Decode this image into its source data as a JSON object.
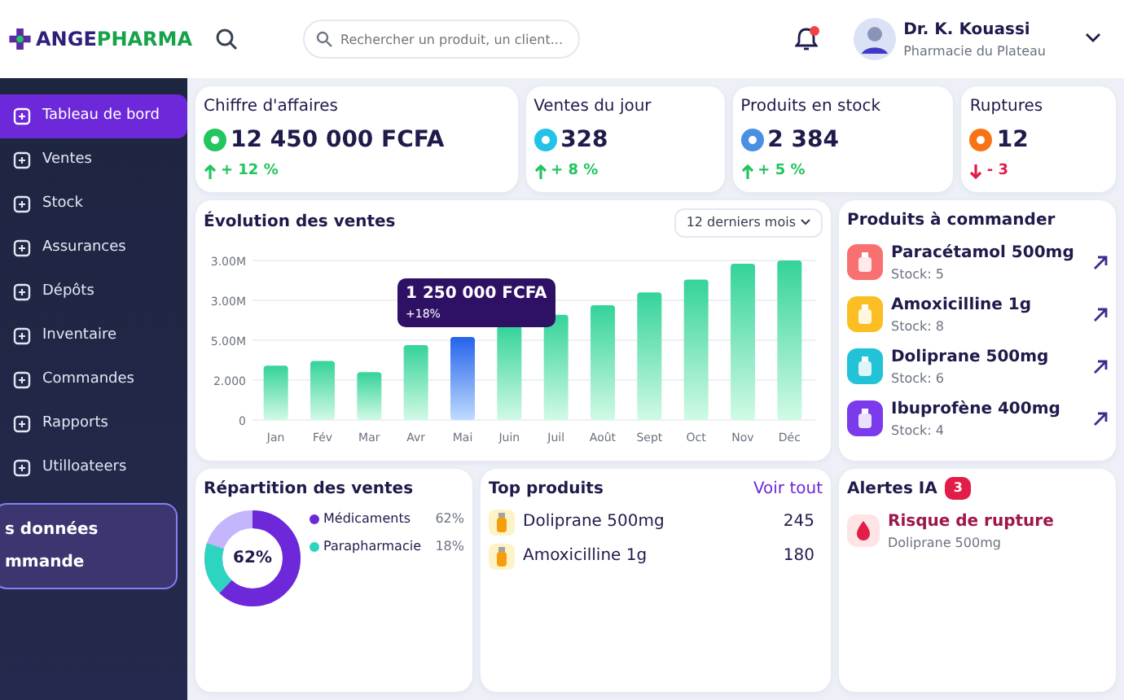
{
  "brand": {
    "part_1": "ANGE",
    "part_2": "PHARMA"
  },
  "search": {
    "placeholder": "Rechercher un produit, un client..."
  },
  "notifications": {
    "unread": true
  },
  "user": {
    "name": "Dr. K. Kouassi",
    "pharmacy": "Pharmacie du Plateau"
  },
  "sidebar": {
    "items": [
      {
        "label": "Tableau de bord",
        "selected": true
      },
      {
        "label": "Ventes",
        "selected": false
      },
      {
        "label": "Stock",
        "selected": false
      },
      {
        "label": "Assurances",
        "selected": false
      },
      {
        "label": "Dépôts",
        "selected": false
      },
      {
        "label": "Inventaire",
        "selected": false
      },
      {
        "label": "Commandes",
        "selected": false
      },
      {
        "label": "Rapports",
        "selected": false
      },
      {
        "label": "Utilloateers",
        "selected": false
      }
    ],
    "promo": {
      "line_1": "s données",
      "line_2": "mmande"
    }
  },
  "kpis": [
    {
      "title": "Chiffre d'affaires",
      "value": "12 450 000 FCFA",
      "change": "+ 12 %",
      "kind": "up",
      "color": "#22c55e"
    },
    {
      "title": "Ventes du jour",
      "value": "328",
      "change": "+ 8 %",
      "kind": "up",
      "color": "#22c3e6"
    },
    {
      "title": "Produits en stock",
      "value": "2 384",
      "change": "+ 5 %",
      "kind": "up",
      "color": "#4a90e2"
    },
    {
      "title": "Ruptures",
      "value": "12",
      "change": "- 3",
      "kind": "down",
      "color": "#f97316"
    }
  ],
  "sales_chart": {
    "title": "Évolution des ventes",
    "period": "12 derniers mois",
    "y_labels": [
      "3.00M",
      "3.00M",
      "5.00M",
      "2.000",
      "0"
    ],
    "months": [
      {
        "label": "Jan",
        "selected": false
      },
      {
        "label": "Fév",
        "selected": false
      },
      {
        "label": "Mar",
        "selected": false
      },
      {
        "label": "Avr",
        "selected": false
      },
      {
        "label": "Mai",
        "selected": true
      },
      {
        "label": "Juin",
        "selected": false
      },
      {
        "label": "Juil",
        "selected": false
      },
      {
        "label": "Août",
        "selected": false
      },
      {
        "label": "Sept",
        "selected": false
      },
      {
        "label": "Oct",
        "selected": false
      },
      {
        "label": "Nov",
        "selected": false
      },
      {
        "label": "Déc",
        "selected": false
      }
    ],
    "tooltip": {
      "value": "1 250 000 FCFA",
      "change": "+18%"
    }
  },
  "to_order": {
    "title": "Produits à commander",
    "items": [
      {
        "name": "Paracétamol 500mg",
        "stock": "Stock: 5",
        "color": "#f87171"
      },
      {
        "name": "Amoxicilline 1g",
        "stock": "Stock: 8",
        "color": "#fbbf24"
      },
      {
        "name": "Doliprane 500mg",
        "stock": "Stock: 6",
        "color": "#22c3d6"
      },
      {
        "name": "Ibuprofène 400mg",
        "stock": "Stock: 4",
        "color": "#7c3aed"
      }
    ]
  },
  "distribution": {
    "title": "Répartition des ventes",
    "center": "62%",
    "legend": [
      {
        "label": "Médicaments",
        "share": "62%",
        "color": "#6d28d9"
      },
      {
        "label": "Parapharmacie",
        "share": "18%",
        "color": "#2dd4bf"
      }
    ]
  },
  "top_products": {
    "title": "Top produits",
    "link": "Voir tout",
    "items": [
      {
        "name": "Doliprane 500mg",
        "count": "245"
      },
      {
        "name": "Amoxicilline 1g",
        "count": "180"
      }
    ]
  },
  "ai_alerts": {
    "title": "Alertes IA",
    "count": "3",
    "items": [
      {
        "title": "Risque de rupture",
        "detail": "Doliprane 500mg"
      }
    ]
  }
}
